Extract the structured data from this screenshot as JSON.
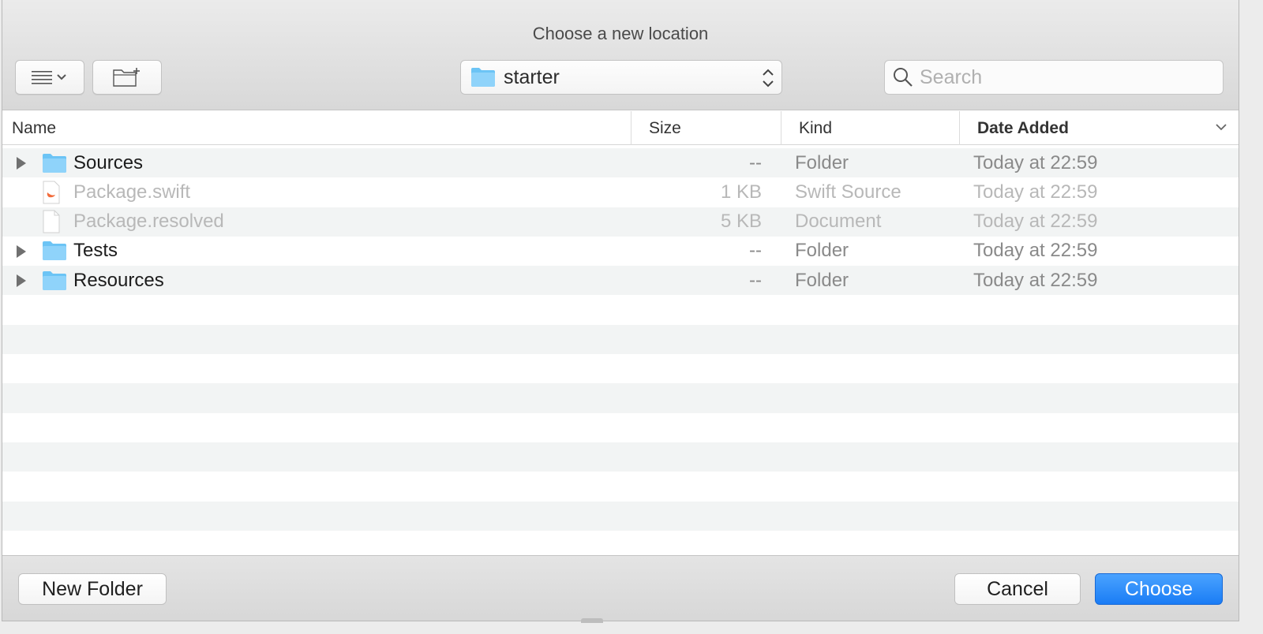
{
  "dialog": {
    "title": "Choose a new location"
  },
  "toolbar": {
    "view_button_icon": "list-view-icon",
    "new_folder_icon": "new-folder-icon",
    "path_selected": "starter",
    "search_placeholder": "Search"
  },
  "columns": {
    "name": "Name",
    "size": "Size",
    "kind": "Kind",
    "date_added": "Date Added"
  },
  "rows": [
    {
      "name": "Sources",
      "size": "--",
      "kind": "Folder",
      "date": "Today at 22:59",
      "type": "folder",
      "expandable": true,
      "enabled": true
    },
    {
      "name": "Package.swift",
      "size": "1 KB",
      "kind": "Swift Source",
      "date": "Today at 22:59",
      "type": "swift",
      "expandable": false,
      "enabled": false
    },
    {
      "name": "Package.resolved",
      "size": "5 KB",
      "kind": "Document",
      "date": "Today at 22:59",
      "type": "document",
      "expandable": false,
      "enabled": false
    },
    {
      "name": "Tests",
      "size": "--",
      "kind": "Folder",
      "date": "Today at 22:59",
      "type": "folder",
      "expandable": true,
      "enabled": true
    },
    {
      "name": "Resources",
      "size": "--",
      "kind": "Folder",
      "date": "Today at 22:59",
      "type": "folder",
      "expandable": true,
      "enabled": true
    }
  ],
  "footer": {
    "new_folder_label": "New Folder",
    "cancel_label": "Cancel",
    "choose_label": "Choose"
  },
  "colors": {
    "accent": "#1a7cf5",
    "folder": "#6cc4f5"
  }
}
